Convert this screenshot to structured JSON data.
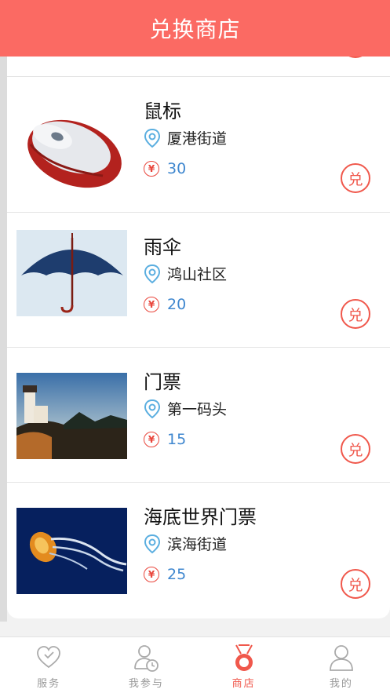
{
  "header": {
    "title": "兑换商店"
  },
  "items": [
    {
      "name": "鼠标",
      "location": "厦港街道",
      "price": "30",
      "redeem_label": "兑",
      "image_icon": "mouse-image"
    },
    {
      "name": "雨伞",
      "location": "鸿山社区",
      "price": "20",
      "redeem_label": "兑",
      "image_icon": "umbrella-image"
    },
    {
      "name": "门票",
      "location": "第一码头",
      "price": "15",
      "redeem_label": "兑",
      "image_icon": "lighthouse-image"
    },
    {
      "name": "海底世界门票",
      "location": "滨海街道",
      "price": "25",
      "redeem_label": "兑",
      "image_icon": "jellyfish-image"
    }
  ],
  "price_symbol": "¥",
  "tabs": [
    {
      "label": "服务",
      "icon": "heart-icon",
      "active": false
    },
    {
      "label": "我参与",
      "icon": "user-clock-icon",
      "active": false
    },
    {
      "label": "商店",
      "icon": "medal-icon",
      "active": true
    },
    {
      "label": "我的",
      "icon": "user-icon",
      "active": false
    }
  ],
  "colors": {
    "accent": "#fb6a63",
    "price": "#3f87cf",
    "pin": "#5aaee0"
  }
}
